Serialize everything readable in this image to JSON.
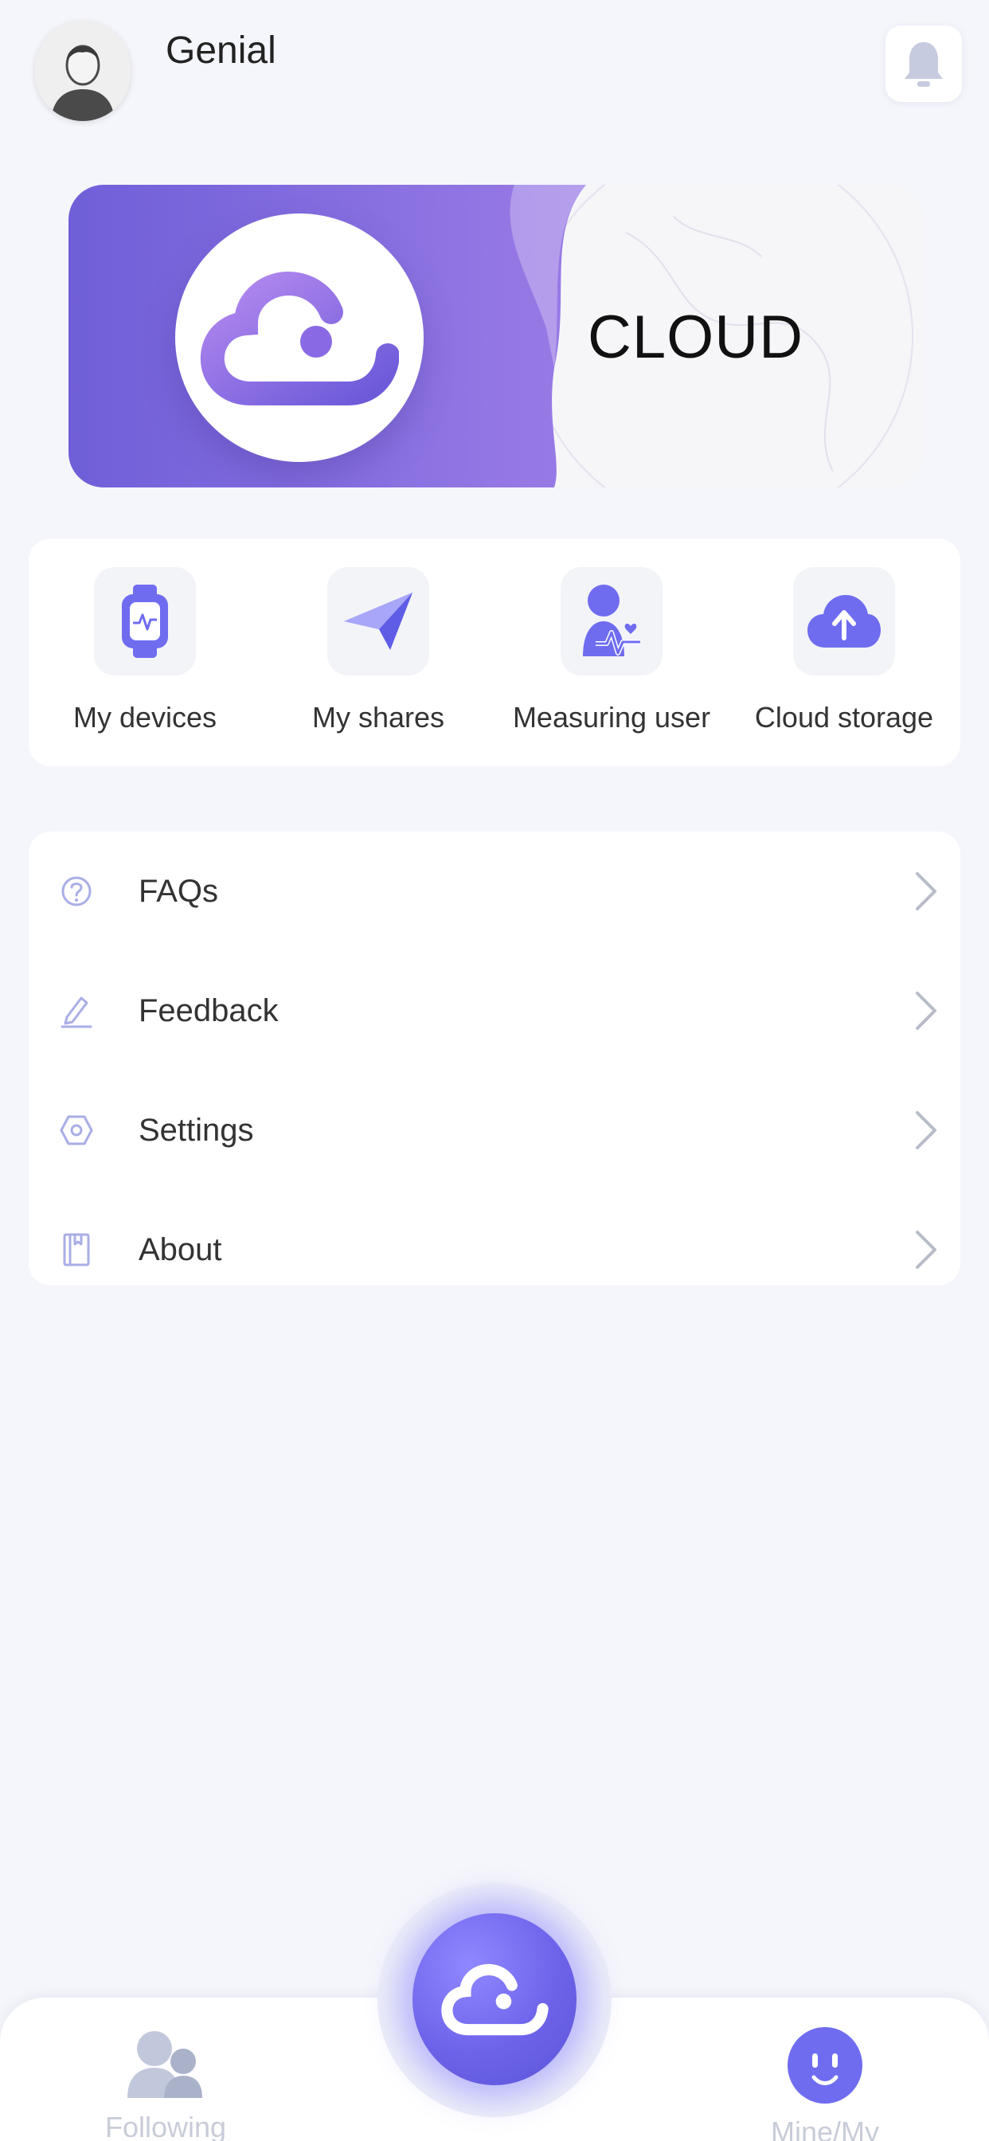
{
  "header": {
    "username": "Genial",
    "avatar_icon": "user-avatar-icon",
    "notification_icon": "bell-icon"
  },
  "banner": {
    "text": "CLOUD",
    "logo_icon": "cloud-logo-icon",
    "colors": {
      "gradient_start": "#6f5fd8",
      "gradient_end": "#9a7be6"
    }
  },
  "quick_actions": [
    {
      "label": "My devices",
      "icon": "smartwatch-icon"
    },
    {
      "label": "My shares",
      "icon": "paper-plane-icon"
    },
    {
      "label": "Measuring user",
      "icon": "user-heartbeat-icon"
    },
    {
      "label": "Cloud storage",
      "icon": "cloud-upload-icon"
    }
  ],
  "menu": [
    {
      "label": "FAQs",
      "icon": "question-circle-icon"
    },
    {
      "label": "Feedback",
      "icon": "pencil-icon"
    },
    {
      "label": "Settings",
      "icon": "hexagon-gear-icon"
    },
    {
      "label": "About",
      "icon": "book-icon"
    }
  ],
  "tabbar": {
    "left": {
      "label": "Following",
      "icon": "people-icon"
    },
    "center": {
      "icon": "cloud-logo-icon"
    },
    "right": {
      "label": "Mine/My",
      "icon": "smiley-face-icon"
    }
  },
  "colors": {
    "accent": "#6f6cf0",
    "background": "#f5f6fb",
    "muted": "#c8ccd8"
  }
}
